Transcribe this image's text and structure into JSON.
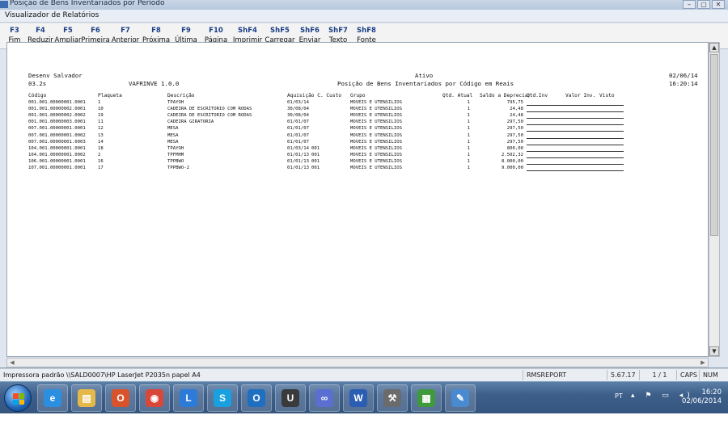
{
  "window": {
    "outer_title": "Posição de Bens Inventariados por Período",
    "inner_title": "Visualizador de Relatórios",
    "controls": [
      "–",
      "▢",
      "✕"
    ]
  },
  "toolbar": [
    {
      "key": "F3",
      "label": "Fim"
    },
    {
      "key": "F4",
      "label": "Reduzir"
    },
    {
      "key": "F5",
      "label": "Ampliar"
    },
    {
      "key": "F6",
      "label": "Primeira"
    },
    {
      "key": "F7",
      "label": "Anterior"
    },
    {
      "key": "F8",
      "label": "Próxima"
    },
    {
      "key": "F9",
      "label": "Última"
    },
    {
      "key": "F10",
      "label": "Página"
    },
    {
      "key": "ShF4",
      "label": "Imprimir"
    },
    {
      "key": "ShF5",
      "label": "Carregar"
    },
    {
      "key": "ShF6",
      "label": "Enviar"
    },
    {
      "key": "ShF7",
      "label": "Texto"
    },
    {
      "key": "ShF8",
      "label": "Fonte"
    }
  ],
  "report": {
    "company": "Desenv Salvador",
    "version": "03.2s",
    "program": "VAFRINVE 1.0.0",
    "status": "Ativo",
    "title": "Posição de Bens Inventariados por Código em Reais",
    "date": "02/06/14",
    "time": "16:20:14",
    "headers": {
      "codigo": "Código",
      "plaqueta": "Plaqueta",
      "descricao": "Descrição",
      "aquisicao_custo": "Aquisição C. Custo",
      "grupo": "Grupo",
      "qtd_atual": "Qtd. Atual",
      "saldo_depreciar": "Saldo a Depreciar",
      "qtd_inv": "Qtd.Inv",
      "valor_inv": "Valor Inv.",
      "visto": "Visto"
    },
    "rows": [
      {
        "codigo": "001.001.00000001.0001",
        "plaqueta": "1",
        "descricao": "TPAYOH",
        "aquisicao": "01/03/14",
        "custo": "",
        "grupo": "MOVEIS E UTENSILIOS",
        "qtd": "1",
        "saldo": "795,75"
      },
      {
        "codigo": "001.001.00000002.0001",
        "plaqueta": "10",
        "descricao": "CADEIRA DE ESCRITORIO COM RODAS",
        "aquisicao": "30/08/04",
        "custo": "",
        "grupo": "MOVEIS E UTENSILIOS",
        "qtd": "1",
        "saldo": "24,48"
      },
      {
        "codigo": "001.001.00000002.0002",
        "plaqueta": "19",
        "descricao": "CADEIRA DE ESCRITORIO COM RODAS",
        "aquisicao": "30/08/04",
        "custo": "",
        "grupo": "MOVEIS E UTENSILIOS",
        "qtd": "1",
        "saldo": "24,48"
      },
      {
        "codigo": "001.001.00000003.0001",
        "plaqueta": "11",
        "descricao": "CADEIRA GIRATORIA",
        "aquisicao": "01/01/07",
        "custo": "",
        "grupo": "MOVEIS E UTENSILIOS",
        "qtd": "1",
        "saldo": "297,50"
      },
      {
        "codigo": "007.001.00000001.0001",
        "plaqueta": "12",
        "descricao": "MESA",
        "aquisicao": "01/01/07",
        "custo": "",
        "grupo": "MOVEIS E UTENSILIOS",
        "qtd": "1",
        "saldo": "297,50"
      },
      {
        "codigo": "007.001.00000001.0002",
        "plaqueta": "13",
        "descricao": "MESA",
        "aquisicao": "01/01/07",
        "custo": "",
        "grupo": "MOVEIS E UTENSILIOS",
        "qtd": "1",
        "saldo": "297,50"
      },
      {
        "codigo": "007.001.00000001.0003",
        "plaqueta": "14",
        "descricao": "MESA",
        "aquisicao": "01/01/07",
        "custo": "",
        "grupo": "MOVEIS E UTENSILIOS",
        "qtd": "1",
        "saldo": "297,50"
      },
      {
        "codigo": "104.001.00000001.0001",
        "plaqueta": "18",
        "descricao": "TPAYOH",
        "aquisicao": "01/03/14",
        "custo": "001",
        "grupo": "MOVEIS E UTENSILIOS",
        "qtd": "1",
        "saldo": "800,00"
      },
      {
        "codigo": "104.001.00000001.0002",
        "plaqueta": "2",
        "descricao": "TPFMHM",
        "aquisicao": "01/01/13",
        "custo": "001",
        "grupo": "MOVEIS E UTENSILIOS",
        "qtd": "1",
        "saldo": "2.502,32"
      },
      {
        "codigo": "106.001.00000001.0001",
        "plaqueta": "16",
        "descricao": "TPPBWO",
        "aquisicao": "01/01/13",
        "custo": "001",
        "grupo": "MOVEIS E UTENSILIOS",
        "qtd": "1",
        "saldo": "8.000,00"
      },
      {
        "codigo": "107.001.00000001.0001",
        "plaqueta": "17",
        "descricao": "TPPBWO-2",
        "aquisicao": "01/01/13",
        "custo": "001",
        "grupo": "MOVEIS E UTENSILIOS",
        "qtd": "1",
        "saldo": "9.000,00"
      }
    ]
  },
  "statusbar": {
    "printer": "Impressora padrão \\\\SALD0007\\HP LaserJet P2035n papel A4",
    "report_name": "RMSREPORT",
    "version": "5.67.17",
    "page": "1 / 1",
    "caps": "CAPS",
    "num": "NUM"
  },
  "taskbar": {
    "apps": [
      {
        "name": "ie",
        "glyph": "e",
        "color": "#2a8fe0"
      },
      {
        "name": "explorer",
        "glyph": "▤",
        "color": "#e5b84a"
      },
      {
        "name": "outlook-red",
        "glyph": "O",
        "color": "#d8532c"
      },
      {
        "name": "chrome",
        "glyph": "◉",
        "color": "#d9473a"
      },
      {
        "name": "lync",
        "glyph": "L",
        "color": "#2d7bd8"
      },
      {
        "name": "skype",
        "glyph": "S",
        "color": "#18a0e0"
      },
      {
        "name": "outlook",
        "glyph": "O",
        "color": "#1f6fc1"
      },
      {
        "name": "ultraedit",
        "glyph": "U",
        "color": "#3a3a3a"
      },
      {
        "name": "infinity",
        "glyph": "∞",
        "color": "#5a6fd0"
      },
      {
        "name": "word",
        "glyph": "W",
        "color": "#2b5db3"
      },
      {
        "name": "tool",
        "glyph": "⚒",
        "color": "#6b6b6b"
      },
      {
        "name": "green-app",
        "glyph": "▦",
        "color": "#3f9a3c"
      },
      {
        "name": "paint",
        "glyph": "✎",
        "color": "#4a8ad0"
      }
    ],
    "language": "PT",
    "time": "16:20",
    "date": "02/06/2014"
  }
}
